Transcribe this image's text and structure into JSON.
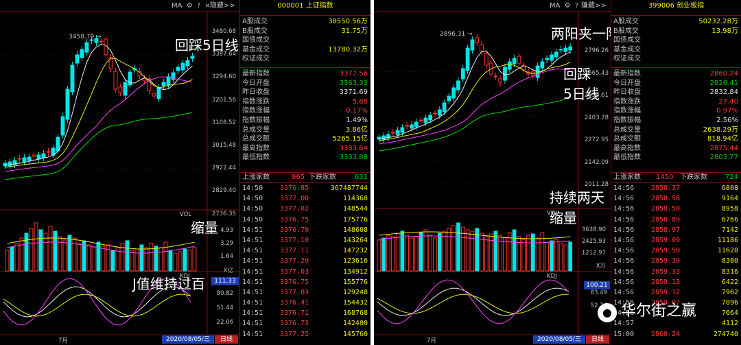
{
  "left": {
    "toolbar": {
      "ma_label": "MA",
      "hide_label": "隐藏>>"
    },
    "code": "000001",
    "name": "上证指数",
    "summary": [
      {
        "label": "A股成交",
        "value": "38550.56万",
        "color": "y"
      },
      {
        "label": "B股成交",
        "value": "31.75万",
        "color": "y"
      },
      {
        "label": "国债成交",
        "value": "",
        "color": "y"
      },
      {
        "label": "基金成交",
        "value": "13780.32万",
        "color": "y"
      },
      {
        "label": "权证成交",
        "value": "",
        "color": "y"
      }
    ],
    "stats": [
      {
        "label": "最新指数",
        "value": "3377.56",
        "color": "r"
      },
      {
        "label": "今日开盘",
        "value": "3363.33",
        "color": "g"
      },
      {
        "label": "昨日收盘",
        "value": "3371.69",
        "color": "w"
      },
      {
        "label": "指数涨跌",
        "value": "5.88",
        "color": "r"
      },
      {
        "label": "指数涨幅",
        "value": "0.17%",
        "color": "r"
      },
      {
        "label": "指数振幅",
        "value": "1.49%",
        "color": "w"
      },
      {
        "label": "总成交量",
        "value": "3.86亿",
        "color": "y"
      },
      {
        "label": "总成交额",
        "value": "5265.15亿",
        "color": "y"
      },
      {
        "label": "最高指数",
        "value": "3383.64",
        "color": "r"
      },
      {
        "label": "最低指数",
        "value": "3333.88",
        "color": "g"
      }
    ],
    "breadth": {
      "up_label": "上涨家数",
      "up": "965",
      "down_label": "下跌家数",
      "down": "631"
    },
    "ticks": [
      [
        "14:50",
        "3376.85",
        "367487744"
      ],
      [
        "14:50",
        "3377.00",
        "114368"
      ],
      [
        "14:50",
        "3377.02",
        "148544"
      ],
      [
        "14:50",
        "3376.75",
        "175776"
      ],
      [
        "14:51",
        "3376.79",
        "148608"
      ],
      [
        "14:51",
        "3377.10",
        "143264"
      ],
      [
        "14:51",
        "3377.11",
        "147232"
      ],
      [
        "14:51",
        "3377.29",
        "123616"
      ],
      [
        "14:51",
        "3377.03",
        "134912"
      ],
      [
        "14:51",
        "3376.75",
        "155776"
      ],
      [
        "14:51",
        "3377.03",
        "129248"
      ],
      [
        "14:51",
        "3376.41",
        "154432"
      ],
      [
        "14:51",
        "3376.71",
        "168768"
      ],
      [
        "14:51",
        "3376.73",
        "142400"
      ],
      [
        "14:51",
        "3377.25",
        "145760"
      ]
    ],
    "price_axis": [
      "3480.68",
      "3387.64",
      "3294.60",
      "3201.56",
      "3108.52",
      "3015.48",
      "2922.44",
      "2829.40",
      "2736.35"
    ],
    "high_mark": "3458.79",
    "vol": {
      "label": "VOL",
      "axis": [
        "4.93",
        "3.29",
        "1.64",
        "X亿"
      ]
    },
    "kdj": {
      "label": "KDJ",
      "current": "111.33",
      "axis": [
        "80.82",
        "51.44",
        "22.06"
      ]
    },
    "month": "7月",
    "date": "2020/08/05/三",
    "period": "日线",
    "annotations": {
      "a1": "回踩5日线",
      "a2": "缩量",
      "a3": "J值维持过百"
    }
  },
  "right": {
    "toolbar": {
      "ma_label": "MA",
      "hide_label": "隐藏>>"
    },
    "code": "399006",
    "name": "创业板指",
    "summary": [
      {
        "label": "A股成交",
        "value": "50232.28万",
        "color": "y"
      },
      {
        "label": "B股成交",
        "value": "13.98万",
        "color": "y"
      },
      {
        "label": "国债成交",
        "value": "",
        "color": "y"
      },
      {
        "label": "基金成交",
        "value": "",
        "color": "y"
      },
      {
        "label": "权证成交",
        "value": "",
        "color": "y"
      }
    ],
    "stats": [
      {
        "label": "最新指数",
        "value": "2860.24",
        "color": "r"
      },
      {
        "label": "今日开盘",
        "value": "2826.41",
        "color": "g"
      },
      {
        "label": "昨日收盘",
        "value": "2832.84",
        "color": "w"
      },
      {
        "label": "指数涨跌",
        "value": "27.40",
        "color": "r"
      },
      {
        "label": "指数涨幅",
        "value": "0.97%",
        "color": "r"
      },
      {
        "label": "指数振幅",
        "value": "2.56%",
        "color": "w"
      },
      {
        "label": "总成交量",
        "value": "2638.29万",
        "color": "y"
      },
      {
        "label": "总成交额",
        "value": "818.94亿",
        "color": "y"
      },
      {
        "label": "最高指数",
        "value": "2875.44",
        "color": "r"
      },
      {
        "label": "最低指数",
        "value": "2803.77",
        "color": "g"
      }
    ],
    "breadth": {
      "up_label": "上涨家数",
      "up": "1450",
      "down_label": "下跌家数",
      "down": "724"
    },
    "ticks": [
      [
        "14:56",
        "2858.37",
        "6808"
      ],
      [
        "14:56",
        "2858.58",
        "9164"
      ],
      [
        "14:56",
        "2858.50",
        "8958"
      ],
      [
        "14:56",
        "2858.89",
        "6766"
      ],
      [
        "14:56",
        "2858.97",
        "7142"
      ],
      [
        "14:56",
        "2859.09",
        "11186"
      ],
      [
        "14:56",
        "2859.50",
        "11628"
      ],
      [
        "14:56",
        "2859.30",
        "8380"
      ],
      [
        "14:56",
        "2859.33",
        "8316"
      ],
      [
        "14:56",
        "2859.13",
        "6422"
      ],
      [
        "14:56",
        "2859.12",
        "7962"
      ],
      [
        "14:56",
        "2859.07",
        "7896"
      ],
      [
        "14:56",
        "",
        "7664"
      ],
      [
        "14:57",
        "",
        "4112"
      ],
      [
        "15:00",
        "2860.24",
        "274740"
      ]
    ],
    "price_axis": [
      "2796.26",
      "2665.43",
      "2534.61",
      "2403.78",
      "2272.95",
      "2142.09",
      "2011.28"
    ],
    "high_mark": "2896.31",
    "vol": {
      "label": "VOL",
      "axis": [
        "3638.90",
        "2425.93",
        "1212.97",
        "X万"
      ]
    },
    "kdj": {
      "label": "KDJ",
      "current": "100.21",
      "axis": [
        "83.49",
        "52.76"
      ]
    },
    "month": "7月",
    "date": "2020/08/05/三",
    "period": "日线",
    "annotations": {
      "a1": "两阳夹一阴",
      "a2": "回踩",
      "a3": "5日线",
      "a4": "持续两天",
      "a5": "缩量"
    },
    "watermark": "华尔街之赢"
  }
}
